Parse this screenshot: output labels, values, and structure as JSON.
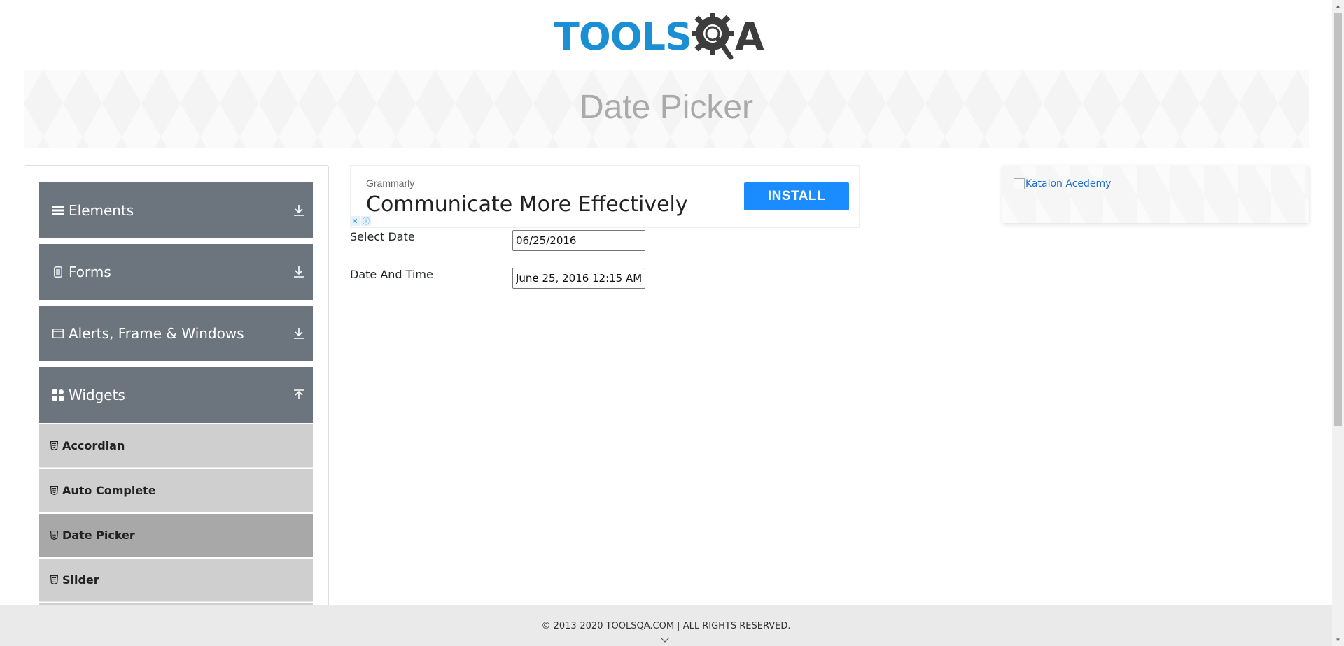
{
  "header": {
    "logo_tools": "TOOLS",
    "logo_qa": "A"
  },
  "banner": {
    "title": "Date Picker"
  },
  "sidebar": {
    "groups": [
      {
        "label": "Elements",
        "icon": "hamburger-icon",
        "arrow": "download-arrow-icon"
      },
      {
        "label": "Forms",
        "icon": "document-icon",
        "arrow": "download-arrow-icon"
      },
      {
        "label": "Alerts, Frame & Windows",
        "icon": "window-icon",
        "arrow": "download-arrow-icon"
      },
      {
        "label": "Widgets",
        "icon": "grid-icon",
        "arrow": "upload-arrow-icon",
        "expanded": true
      }
    ],
    "items": [
      {
        "label": "Accordian",
        "icon": "html5-icon"
      },
      {
        "label": "Auto Complete",
        "icon": "html5-icon"
      },
      {
        "label": "Date Picker",
        "icon": "html5-icon",
        "active": true
      },
      {
        "label": "Slider",
        "icon": "html5-icon"
      }
    ]
  },
  "ad": {
    "brand": "Grammarly",
    "headline": "Communicate More Effectively",
    "install_label": "INSTALL",
    "close_glyph": "✕",
    "info_glyph": "ⓘ"
  },
  "form": {
    "select_date_label": "Select Date",
    "select_date_value": "06/25/2016",
    "date_time_label": "Date And Time",
    "date_time_value": "June 25, 2016 12:15 AM"
  },
  "right_ad": {
    "alt_text": "Katalon Acedemy"
  },
  "footer": {
    "text": "© 2013-2020 TOOLSQA.COM | ALL RIGHTS RESERVED."
  },
  "colors": {
    "logo_blue": "#1a8fd4",
    "logo_dark": "#3d3d3d",
    "group_header_bg": "#6c757d",
    "menu_item_bg": "#cfcfcf",
    "menu_item_active_bg": "#a8a8a8",
    "install_button": "#1a8cff"
  }
}
